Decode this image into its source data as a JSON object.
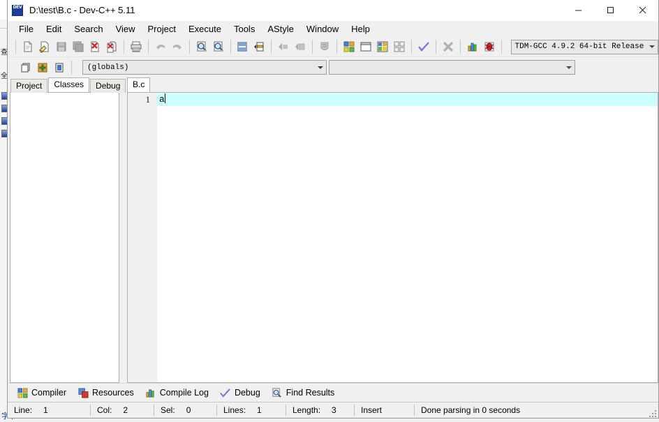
{
  "window": {
    "title": "D:\\test\\B.c - Dev-C++ 5.11",
    "app_icon": "dev-cpp-icon",
    "controls": {
      "minimize": "minimize-icon",
      "maximize": "maximize-icon",
      "close": "close-icon"
    }
  },
  "menu": {
    "items": [
      {
        "label": "File"
      },
      {
        "label": "Edit"
      },
      {
        "label": "Search"
      },
      {
        "label": "View"
      },
      {
        "label": "Project"
      },
      {
        "label": "Execute"
      },
      {
        "label": "Tools"
      },
      {
        "label": "AStyle"
      },
      {
        "label": "Window"
      },
      {
        "label": "Help"
      }
    ]
  },
  "toolbar": {
    "file_group": [
      {
        "name": "new-file-icon",
        "enabled": true
      },
      {
        "name": "open-file-icon",
        "enabled": true
      },
      {
        "name": "save-file-icon",
        "enabled": false
      },
      {
        "name": "save-all-icon",
        "enabled": false
      },
      {
        "name": "close-file-icon",
        "enabled": true
      },
      {
        "name": "close-all-icon",
        "enabled": true
      }
    ],
    "print_group": [
      {
        "name": "print-icon",
        "enabled": true
      }
    ],
    "undo_group": [
      {
        "name": "undo-icon",
        "enabled": false
      },
      {
        "name": "redo-icon",
        "enabled": false
      }
    ],
    "search_group": [
      {
        "name": "find-icon",
        "enabled": true
      },
      {
        "name": "replace-icon",
        "enabled": true
      }
    ],
    "goto_group": [
      {
        "name": "goto-line-icon",
        "enabled": true
      },
      {
        "name": "goto-function-icon",
        "enabled": true
      }
    ],
    "nav_group": [
      {
        "name": "back-icon",
        "enabled": false
      },
      {
        "name": "forward-icon",
        "enabled": false
      }
    ],
    "shield_group": [
      {
        "name": "toggle-bookmark-icon",
        "enabled": false
      }
    ],
    "build_group": [
      {
        "name": "compile-icon",
        "enabled": true
      },
      {
        "name": "run-icon",
        "enabled": true
      },
      {
        "name": "compile-and-run-icon",
        "enabled": true
      },
      {
        "name": "rebuild-all-icon",
        "enabled": true
      }
    ],
    "check_group": [
      {
        "name": "syntax-check-icon",
        "enabled": true
      }
    ],
    "stop_group": [
      {
        "name": "stop-execution-icon",
        "enabled": false
      }
    ],
    "profile_group": [
      {
        "name": "profile-icon",
        "enabled": true
      },
      {
        "name": "debug-icon",
        "enabled": true
      }
    ],
    "compiler_select": {
      "value": "TDM-GCC 4.9.2 64-bit Release"
    }
  },
  "toolbar_second": {
    "project_group": [
      {
        "name": "new-project-icon",
        "enabled": true
      },
      {
        "name": "add-to-project-icon",
        "enabled": true
      },
      {
        "name": "remove-from-project-icon",
        "enabled": true
      }
    ],
    "scope_combo": {
      "value": "(globals)"
    },
    "symbol_combo": {
      "value": ""
    }
  },
  "left_panel": {
    "tabs": [
      {
        "label": "Project",
        "active": false
      },
      {
        "label": "Classes",
        "active": true
      },
      {
        "label": "Debug",
        "active": false
      }
    ]
  },
  "editor": {
    "tabs": [
      {
        "label": "B.c",
        "active": true
      }
    ],
    "lines": [
      {
        "number": "1",
        "text": "a",
        "active": true
      }
    ]
  },
  "bottom_panel": {
    "tabs": [
      {
        "label": "Compiler",
        "icon": "compiler-icon"
      },
      {
        "label": "Resources",
        "icon": "resources-icon"
      },
      {
        "label": "Compile Log",
        "icon": "compile-log-icon"
      },
      {
        "label": "Debug",
        "icon": "debug-check-icon"
      },
      {
        "label": "Find Results",
        "icon": "find-results-icon"
      }
    ]
  },
  "status_bar": {
    "line_label": "Line:",
    "line_value": "1",
    "col_label": "Col:",
    "col_value": "2",
    "sel_label": "Sel:",
    "sel_value": "0",
    "lines_label": "Lines:",
    "lines_value": "1",
    "length_label": "Length:",
    "length_value": "3",
    "insert_mode": "Insert",
    "message": "Done parsing in 0 seconds"
  },
  "background": {
    "glyph_top": "查",
    "glyph_mid": "全",
    "taskbar_text": "字节"
  },
  "colors": {
    "active_line": "#ccfffe",
    "window_bg": "#f0f0f0",
    "editor_bg": "#ffffff",
    "accent_blue": "#1c3f9e"
  }
}
